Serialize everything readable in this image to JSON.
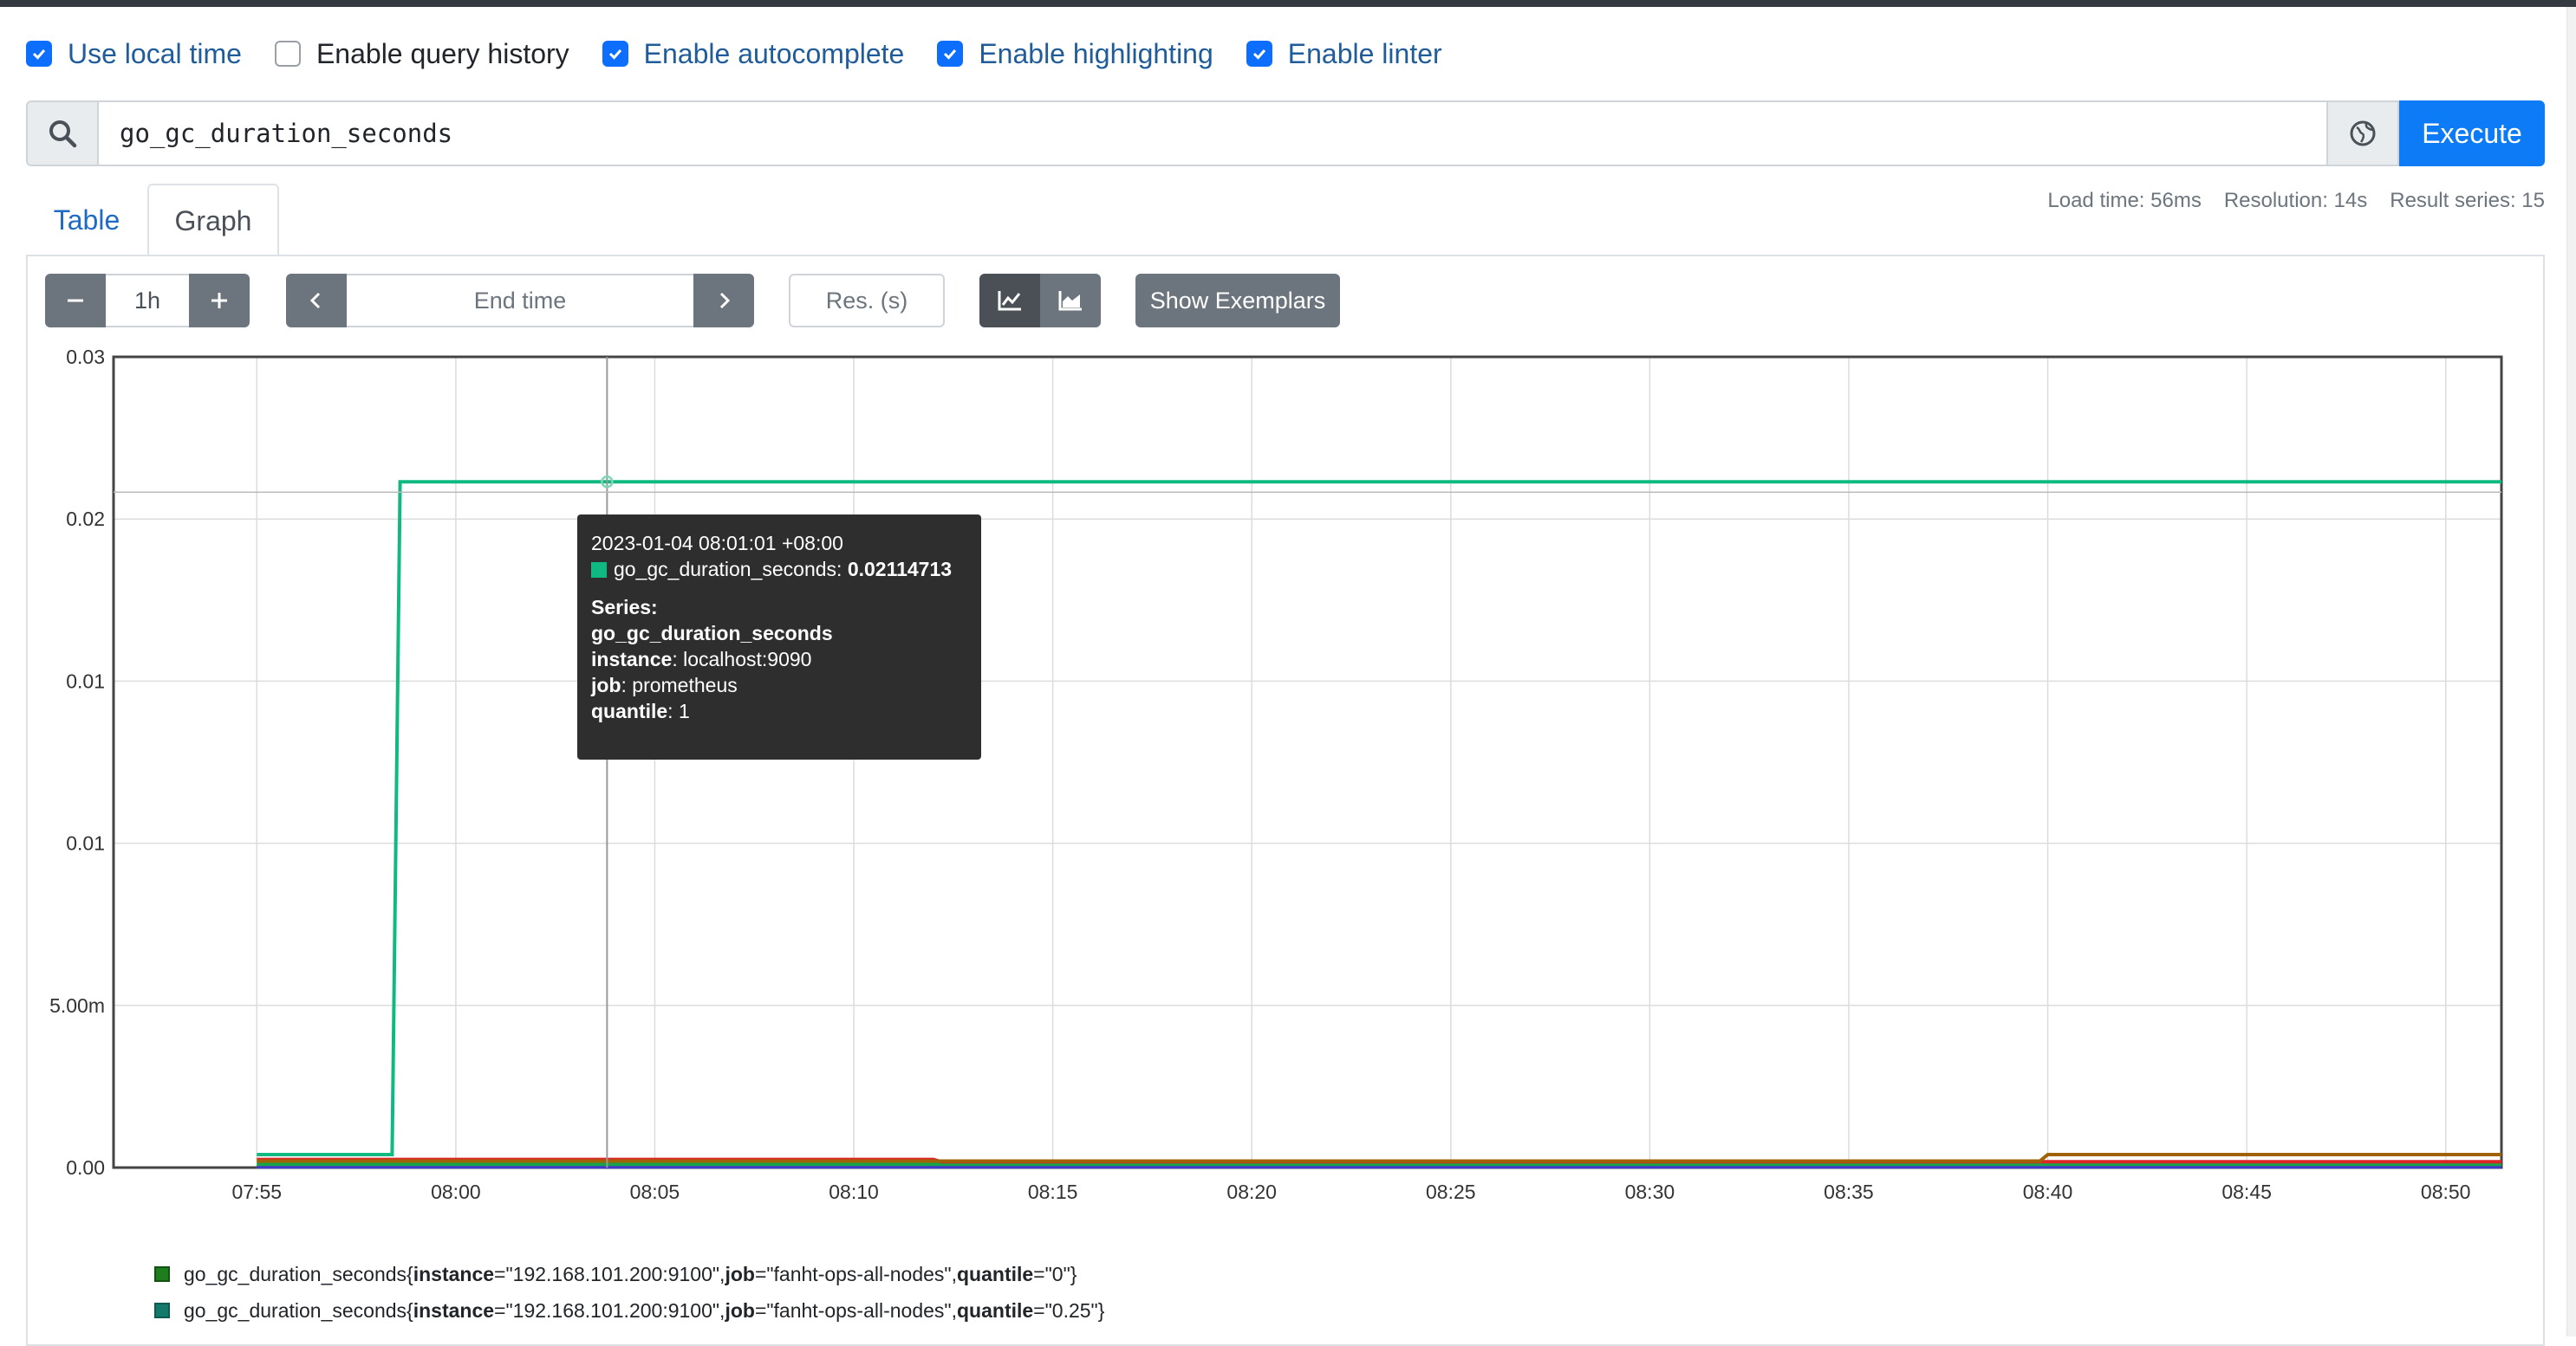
{
  "settings": [
    {
      "label": "Use local time",
      "checked": true
    },
    {
      "label": "Enable query history",
      "checked": false
    },
    {
      "label": "Enable autocomplete",
      "checked": true
    },
    {
      "label": "Enable highlighting",
      "checked": true
    },
    {
      "label": "Enable linter",
      "checked": true
    }
  ],
  "query": {
    "expression": "go_gc_duration_seconds",
    "execute_label": "Execute"
  },
  "tabs": {
    "table": "Table",
    "graph": "Graph"
  },
  "stats": {
    "load_time": "Load time: 56ms",
    "resolution": "Resolution: 14s",
    "result_series": "Result series: 15"
  },
  "controls": {
    "range": "1h",
    "end_time_placeholder": "End time",
    "resolution_placeholder": "Res. (s)",
    "show_exemplars": "Show Exemplars",
    "icons": [
      "minus-icon",
      "plus-icon",
      "chevron-left-icon",
      "chevron-right-icon",
      "line-chart-icon",
      "stacked-chart-icon"
    ]
  },
  "tooltip": {
    "timestamp": "2023-01-04 08:01:01 +08:00",
    "metric": "go_gc_duration_seconds:",
    "value": "0.02114713",
    "series_heading": "Series:",
    "series_name": "go_gc_duration_seconds",
    "instance_key": "instance",
    "instance_value": ": localhost:9090",
    "job_key": "job",
    "job_value": ": prometheus",
    "quantile_key": "quantile",
    "quantile_value": ": 1"
  },
  "legend": [
    {
      "prefix": "go_gc_duration_seconds{",
      "instance": "\"192.168.101.200:9100\"",
      "job": "\"fanht-ops-all-nodes\"",
      "quantile": "\"0\"",
      "color": "#1e7e1e"
    },
    {
      "prefix": "go_gc_duration_seconds{",
      "instance": "\"192.168.101.200:9100\"",
      "job": "\"fanht-ops-all-nodes\"",
      "quantile": "\"0.25\"",
      "color": "#137a6b"
    }
  ],
  "chart_data": {
    "type": "line",
    "x_ticks": [
      "07:55",
      "08:00",
      "08:05",
      "08:10",
      "08:15",
      "08:20",
      "08:25",
      "08:30",
      "08:35",
      "08:40",
      "08:45",
      "08:50"
    ],
    "y_ticks": [
      "0.00",
      "5.00m",
      "0.01",
      "0.01",
      "0.02",
      "0.03"
    ],
    "ylim": [
      0,
      0.025
    ],
    "xlim_minutes": [
      -3.6,
      56.4
    ],
    "grid": true,
    "series": [
      {
        "color": "#10b981",
        "highlighted": true,
        "x": [
          0,
          3.4,
          3.6,
          56.4
        ],
        "y": [
          0.0004,
          0.0004,
          0.02114713,
          0.02114713
        ]
      },
      {
        "color": "#a16207",
        "x": [
          0,
          44.8,
          45.0,
          56.4
        ],
        "y": [
          0.0002,
          0.0002,
          0.0004,
          0.0004
        ]
      },
      {
        "color": "#dc2626",
        "x": [
          0,
          17.0,
          17.2,
          56.4
        ],
        "y": [
          0.00025,
          0.00025,
          0.00018,
          0.00018
        ]
      },
      {
        "color": "#16a34a",
        "x": [
          0,
          56.4
        ],
        "y": [
          0.0001,
          0.0001
        ]
      },
      {
        "color": "#4338ca",
        "x": [
          0,
          56.4
        ],
        "y": [
          2e-05,
          2e-05
        ]
      }
    ],
    "hover": {
      "x": 8.8,
      "y": 0.02114713
    }
  }
}
